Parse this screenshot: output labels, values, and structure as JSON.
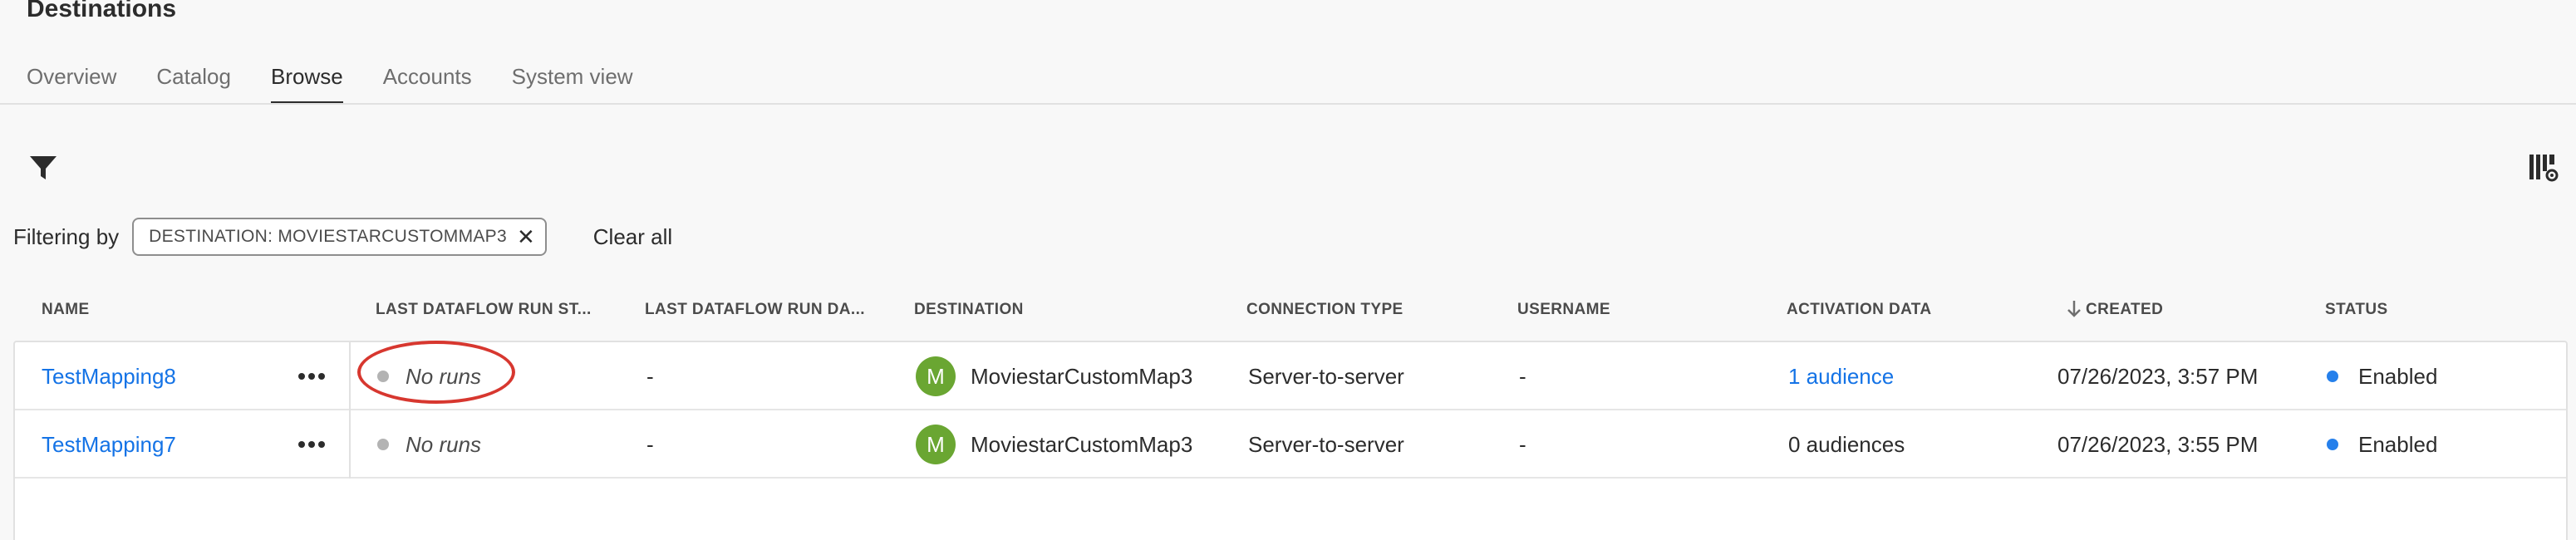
{
  "page": {
    "title": "Destinations"
  },
  "tabs": [
    {
      "label": "Overview",
      "active": false
    },
    {
      "label": "Catalog",
      "active": false
    },
    {
      "label": "Browse",
      "active": true
    },
    {
      "label": "Accounts",
      "active": false
    },
    {
      "label": "System view",
      "active": false
    }
  ],
  "toolbar": {
    "filter_icon": "funnel-icon",
    "settings_icon": "column-settings-icon"
  },
  "filters": {
    "label": "Filtering by",
    "chips": [
      {
        "text": "DESTINATION: MOVIESTARCUSTOMMAP3"
      }
    ],
    "clear_all": "Clear all"
  },
  "table": {
    "columns": [
      "NAME",
      "LAST DATAFLOW RUN ST...",
      "LAST DATAFLOW RUN DA...",
      "DESTINATION",
      "CONNECTION TYPE",
      "USERNAME",
      "ACTIVATION DATA",
      "CREATED",
      "STATUS"
    ],
    "sort": {
      "column": "CREATED",
      "direction": "descending"
    },
    "rows": [
      {
        "name": "TestMapping8",
        "run_status": "No runs",
        "run_date": "-",
        "destination_initial": "M",
        "destination": "MoviestarCustomMap3",
        "connection_type": "Server-to-server",
        "username": "-",
        "activation_data": "1 audience",
        "created": "07/26/2023, 3:57 PM",
        "status": "Enabled"
      },
      {
        "name": "TestMapping7",
        "run_status": "No runs",
        "run_date": "-",
        "destination_initial": "M",
        "destination": "MoviestarCustomMap3",
        "connection_type": "Server-to-server",
        "username": "-",
        "activation_data": "0 audiences",
        "created": "07/26/2023, 3:55 PM",
        "status": "Enabled"
      }
    ]
  },
  "colors": {
    "link": "#1473e6",
    "status_enabled": "#2680eb",
    "avatar": "#6aa632",
    "annotation": "#d7372f"
  }
}
